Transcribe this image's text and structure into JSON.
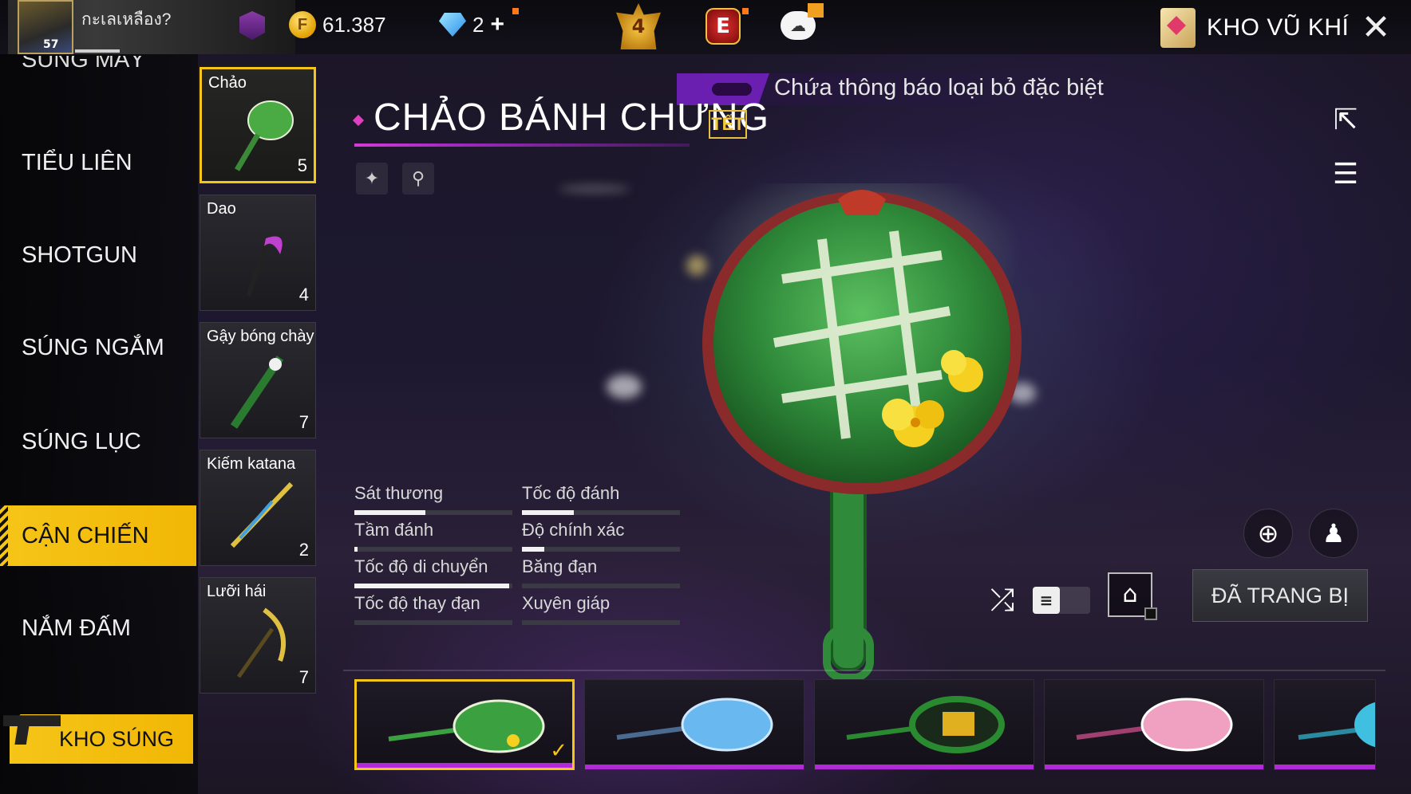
{
  "player": {
    "name": "กะเลเหลือง?",
    "level": "57"
  },
  "currency": {
    "gold": "61.387",
    "diamonds": "2",
    "diamonds_plus": "+"
  },
  "badges": {
    "rank_number": "4",
    "elite_letter": "E"
  },
  "header": {
    "armory_label": "KHO VŨ KHÍ",
    "close_glyph": "✕"
  },
  "sidebar": {
    "partial_top": "SÚNG MÁY",
    "categories": [
      {
        "label": "TIỂU LIÊN",
        "active": false
      },
      {
        "label": "SHOTGUN",
        "active": false
      },
      {
        "label": "SÚNG NGẮM",
        "active": false
      },
      {
        "label": "SÚNG LỤC",
        "active": false
      },
      {
        "label": "CẬN CHIẾN",
        "active": true
      },
      {
        "label": "NẮM ĐẤM",
        "active": false
      }
    ],
    "gun_store_label": "KHO SÚNG"
  },
  "weapon_types": [
    {
      "label": "Chảo",
      "count": "5",
      "active": true
    },
    {
      "label": "Dao",
      "count": "4",
      "active": false
    },
    {
      "label": "Gậy bóng chày",
      "count": "7",
      "active": false
    },
    {
      "label": "Kiếm katana",
      "count": "2",
      "active": false
    },
    {
      "label": "Lưỡi hái",
      "count": "7",
      "active": false
    }
  ],
  "weapon": {
    "title": "CHẢO BÁNH CHƯNG",
    "tag": "TẾT",
    "notice": "Chứa thông báo loại bỏ đặc biệt",
    "attribute_icons": [
      "bell-icon",
      "runner-icon"
    ]
  },
  "stats": [
    {
      "label": "Sát thương",
      "value": 0.45
    },
    {
      "label": "Tốc độ đánh",
      "value": 0.33
    },
    {
      "label": "Tầm đánh",
      "value": 0.02
    },
    {
      "label": "Độ chính xác",
      "value": 0.14
    },
    {
      "label": "Tốc độ di chuyển",
      "value": 0.98
    },
    {
      "label": "Băng đạn",
      "value": 0
    },
    {
      "label": "Tốc độ thay đạn",
      "value": 0
    },
    {
      "label": "Xuyên giáp",
      "value": 0
    }
  ],
  "actions": {
    "equipped_label": "ĐÃ TRANG BỊ",
    "list_toggle_glyph": "≡"
  },
  "skins": [
    {
      "name": "banh-chung-pan",
      "color": "#3aa040",
      "active": true,
      "check": "✓"
    },
    {
      "name": "ice-pan",
      "color": "#6ab8f0",
      "active": false
    },
    {
      "name": "gold-ring-pan",
      "color": "#2a8a30",
      "active": false
    },
    {
      "name": "pink-pan",
      "color": "#f0a0c0",
      "active": false
    },
    {
      "name": "cyan-pan",
      "color": "#40c0e0",
      "active": false
    }
  ],
  "colors": {
    "accent": "#f5c518",
    "purple": "#b22ad8"
  }
}
